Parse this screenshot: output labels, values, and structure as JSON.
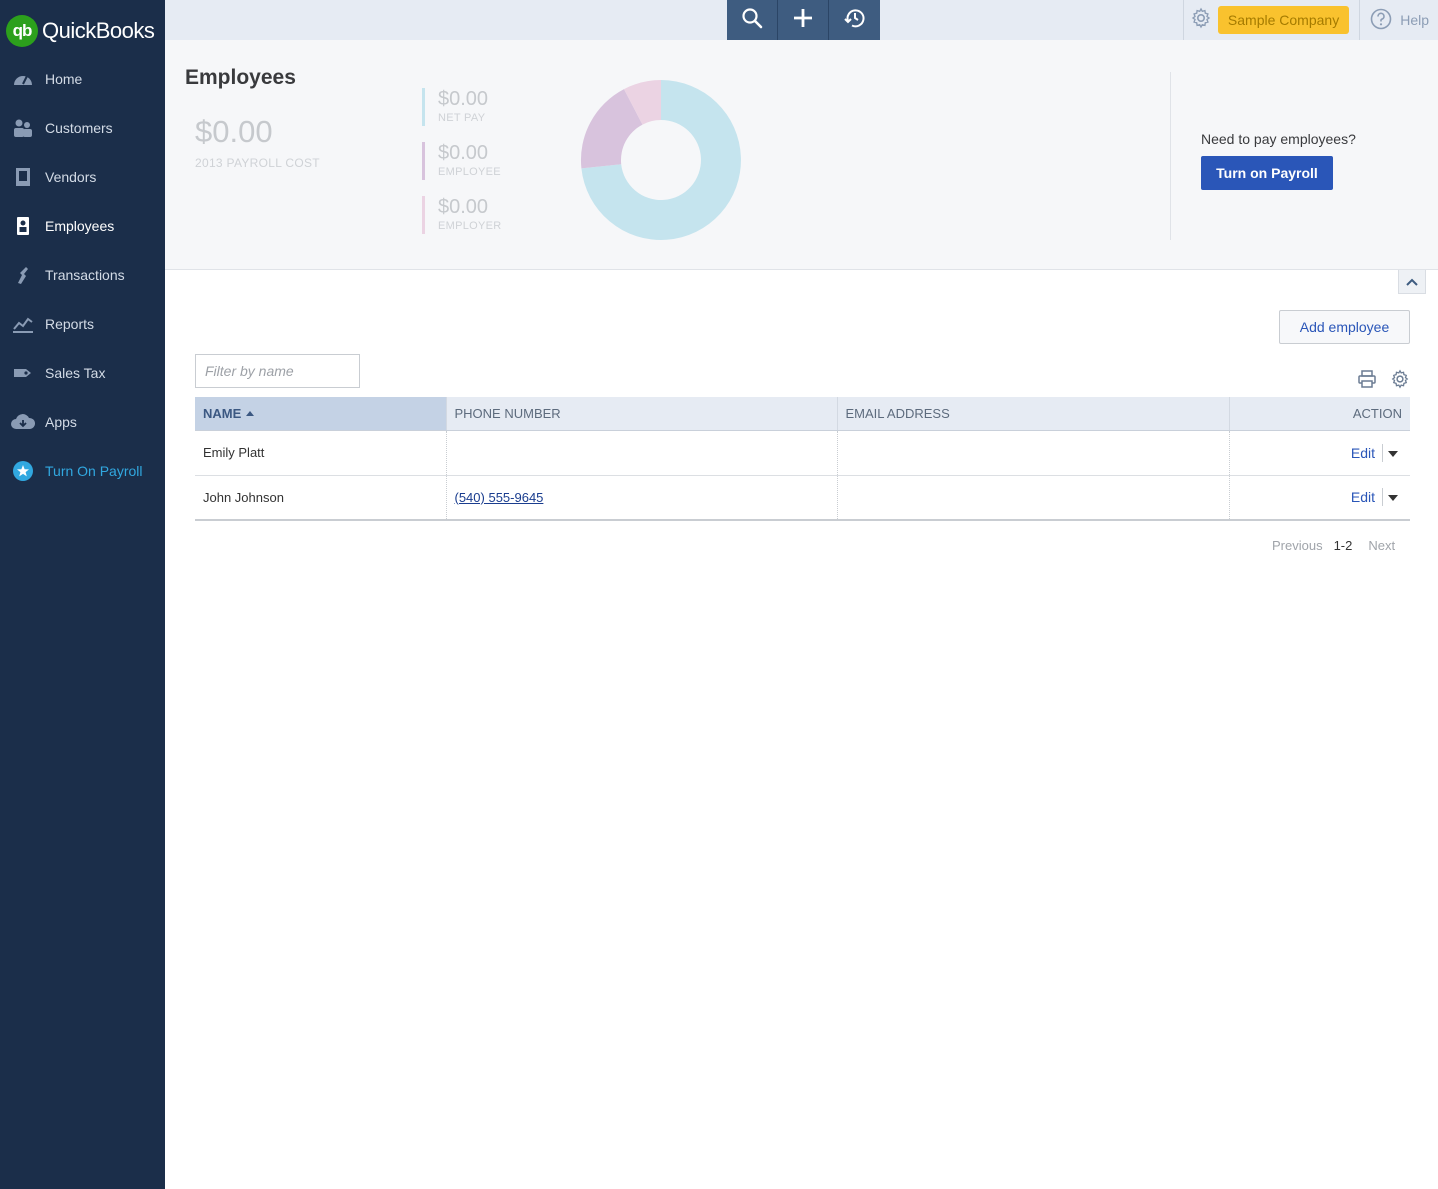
{
  "app": {
    "logo_mark": "qb",
    "logo_text": "QuickBooks"
  },
  "sidebar": {
    "items": [
      {
        "label": "Home",
        "icon": "dashboard-icon"
      },
      {
        "label": "Customers",
        "icon": "customers-icon"
      },
      {
        "label": "Vendors",
        "icon": "vendors-icon"
      },
      {
        "label": "Employees",
        "icon": "employees-icon",
        "active": true
      },
      {
        "label": "Transactions",
        "icon": "transactions-icon"
      },
      {
        "label": "Reports",
        "icon": "reports-icon"
      },
      {
        "label": "Sales Tax",
        "icon": "sales-tax-icon"
      },
      {
        "label": "Apps",
        "icon": "apps-cloud-icon"
      },
      {
        "label": "Turn On Payroll",
        "icon": "star-icon"
      }
    ]
  },
  "topbar": {
    "quick_actions": [
      "search-icon",
      "plus-icon",
      "recent-history-icon"
    ],
    "company": "Sample Company",
    "help": "Help"
  },
  "summary": {
    "title": "Employees",
    "total_amount": "$0.00",
    "total_label": "2013 PAYROLL COST",
    "breakdown": [
      {
        "amount": "$0.00",
        "label": "NET PAY",
        "color": "#c5e4ee"
      },
      {
        "amount": "$0.00",
        "label": "EMPLOYEE",
        "color": "#d8c3dd"
      },
      {
        "amount": "$0.00",
        "label": "EMPLOYER",
        "color": "#ebd3e3"
      }
    ],
    "payroll_prompt": "Need to pay employees?",
    "payroll_button": "Turn on Payroll"
  },
  "employees": {
    "add_button": "Add employee",
    "filter_placeholder": "Filter by name",
    "columns": {
      "name": "NAME",
      "phone": "PHONE NUMBER",
      "email": "EMAIL ADDRESS",
      "action": "ACTION"
    },
    "rows": [
      {
        "name": "Emily Platt",
        "phone": "",
        "email": "",
        "action": "Edit"
      },
      {
        "name": "John Johnson",
        "phone": "(540) 555-9645",
        "email": "",
        "action": "Edit"
      }
    ],
    "pager": {
      "previous": "Previous",
      "range": "1-2",
      "next": "Next"
    }
  },
  "colors": {
    "sidebar_bg": "#1b2e4a",
    "brand_green": "#2ca01c",
    "accent_blue": "#2a56b8",
    "company_badge": "#f9c22e",
    "payroll_link": "#31a8e0"
  }
}
